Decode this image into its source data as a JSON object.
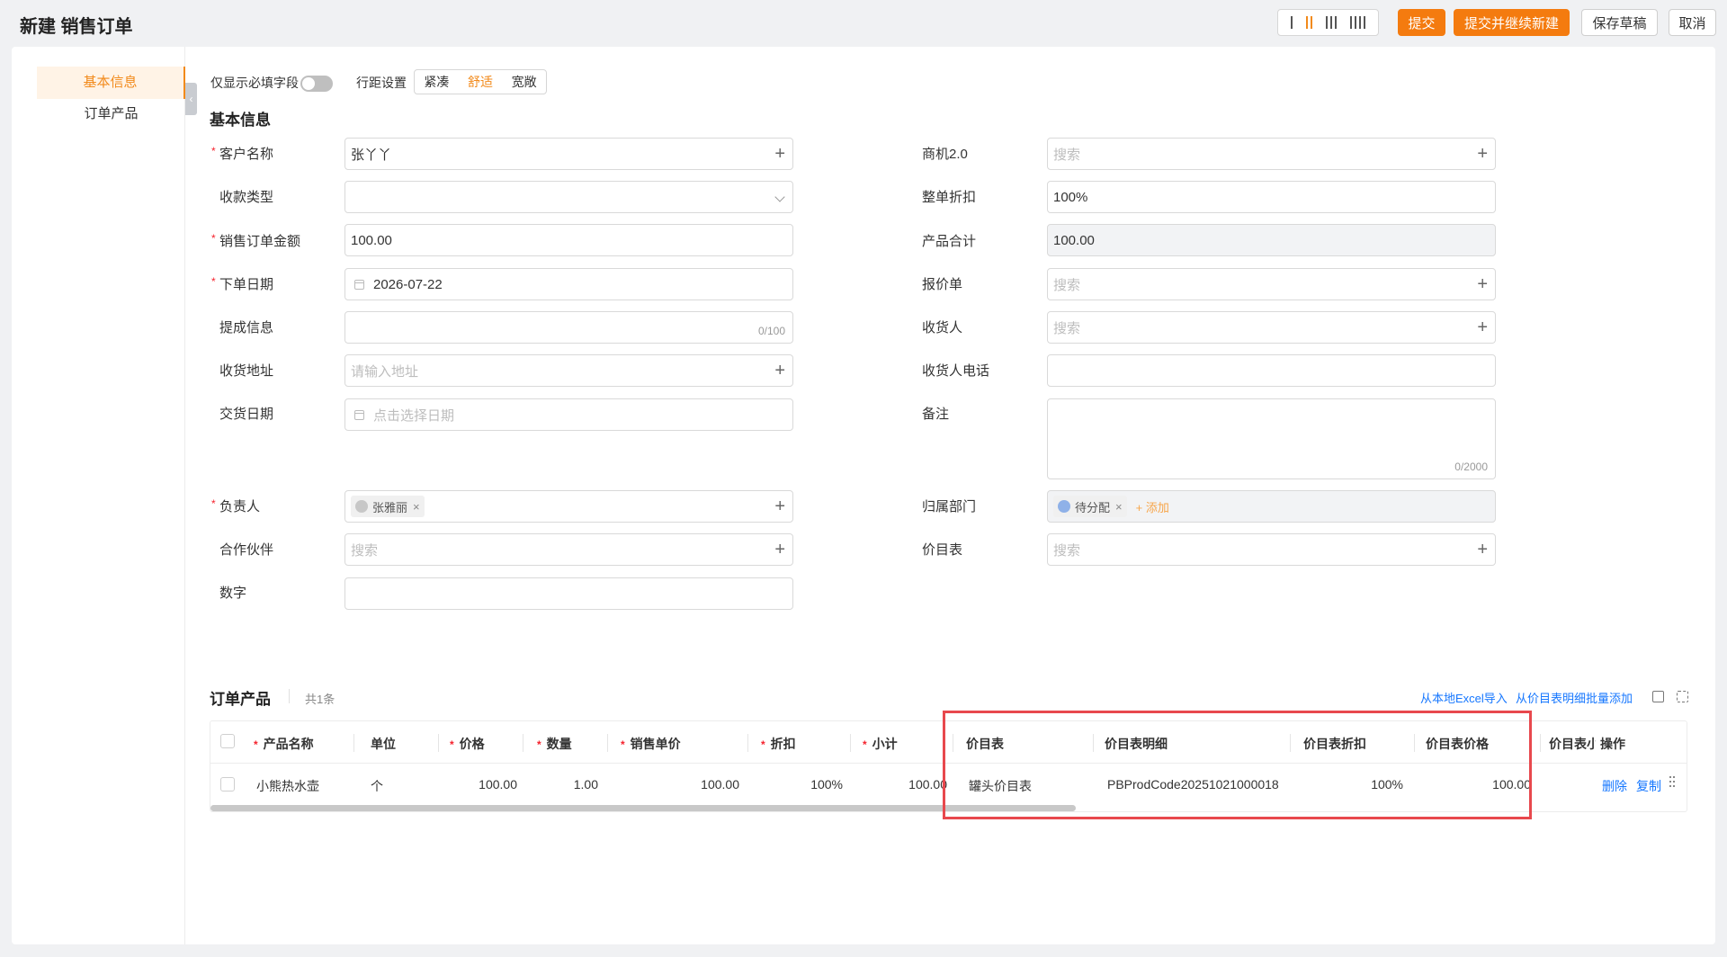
{
  "header": {
    "title": "新建 销售订单",
    "submit_label": "提交",
    "submit_new_label": "提交并继续新建",
    "save_draft_label": "保存草稿",
    "cancel_label": "取消"
  },
  "sidebar": {
    "items": [
      {
        "label": "基本信息",
        "active": true
      },
      {
        "label": "订单产品",
        "active": false
      }
    ]
  },
  "toolbar": {
    "required_only_label": "仅显示必填字段",
    "row_spacing_label": "行距设置",
    "density_options": [
      "紧凑",
      "舒适",
      "宽敞"
    ],
    "density_selected": "舒适"
  },
  "basic": {
    "section_title": "基本信息",
    "customer": {
      "label": "客户名称",
      "value": "张丫丫"
    },
    "payment_type": {
      "label": "收款类型",
      "value": ""
    },
    "amount": {
      "label": "销售订单金额",
      "value": "100.00"
    },
    "order_date": {
      "label": "下单日期",
      "value": "2026-07-22"
    },
    "commission": {
      "label": "提成信息",
      "counter": "0/100"
    },
    "ship_address": {
      "label": "收货地址",
      "placeholder": "请输入地址"
    },
    "delivery_date": {
      "label": "交货日期",
      "placeholder": "点击选择日期"
    },
    "owner": {
      "label": "负责人",
      "tag": "张雅丽"
    },
    "partner": {
      "label": "合作伙伴",
      "placeholder": "搜索"
    },
    "number": {
      "label": "数字",
      "value": ""
    },
    "opportunity": {
      "label": "商机2.0",
      "placeholder": "搜索"
    },
    "discount": {
      "label": "整单折扣",
      "value": "100%"
    },
    "product_total": {
      "label": "产品合计",
      "value": "100.00"
    },
    "quote": {
      "label": "报价单",
      "placeholder": "搜索"
    },
    "receiver": {
      "label": "收货人",
      "placeholder": "搜索"
    },
    "receiver_phone": {
      "label": "收货人电话",
      "value": ""
    },
    "remark": {
      "label": "备注",
      "counter": "0/2000"
    },
    "department": {
      "label": "归属部门",
      "tag": "待分配",
      "add_label": "+ 添加"
    },
    "price_book": {
      "label": "价目表",
      "placeholder": "搜索"
    }
  },
  "products": {
    "section_title": "订单产品",
    "count": "共1条",
    "import_excel_label": "从本地Excel导入",
    "batch_add_label": "从价目表明细批量添加",
    "columns": [
      "产品名称",
      "单位",
      "价格",
      "数量",
      "销售单价",
      "折扣",
      "小计",
      "价目表",
      "价目表明细",
      "价目表折扣",
      "价目表价格",
      "价目表小",
      "操作"
    ],
    "rows": [
      {
        "name": "小熊热水壶",
        "unit": "个",
        "price": "100.00",
        "qty": "1.00",
        "unit_price": "100.00",
        "discount": "100%",
        "subtotal": "100.00",
        "price_book": "罐头价目表",
        "price_book_detail": "PBProdCode20251021000018",
        "price_book_discount": "100%",
        "price_book_price": "100.00",
        "delete_label": "删除",
        "copy_label": "复制"
      }
    ]
  },
  "colors": {
    "accent": "#f47b0f",
    "link": "#1677ff",
    "highlight": "#e8484d"
  }
}
